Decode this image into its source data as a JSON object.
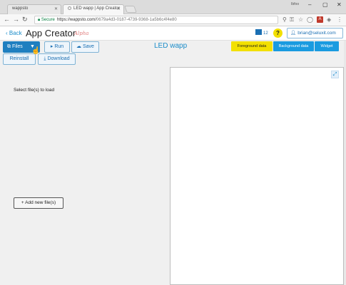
{
  "browser": {
    "tabs": [
      {
        "title": "wappsto",
        "active": false
      },
      {
        "title": "LED wapp | App Creator",
        "active": true
      }
    ],
    "window_user": "Ibfoo",
    "address": {
      "secure_label": "Secure",
      "host": "https://wappsto.com/",
      "path": "0679a4d3-0187-4739-9368-1a5b6c4f4e80"
    }
  },
  "header": {
    "back_label": "Back",
    "app_title": "App Creator",
    "badge": "Alpha",
    "notification_count": "12",
    "help_label": "?",
    "user_email": "brian@seluxit.com"
  },
  "toolbar": {
    "files_label": "Files",
    "run_label": "Run",
    "save_label": "Save",
    "reinstall_label": "Reinstall",
    "download_label": "Download",
    "wapp_title": "LED wapp",
    "foreground_label": "Foreground data",
    "background_label": "Background data",
    "widget_label": "Widget"
  },
  "files_panel": {
    "empty_message": "Select file(s) to load",
    "add_button_label": "+ Add new file(s)"
  },
  "colors": {
    "accent_blue": "#1a9be0",
    "foreground_yellow": "#f2e000",
    "files_button": "#1f7fc0"
  }
}
